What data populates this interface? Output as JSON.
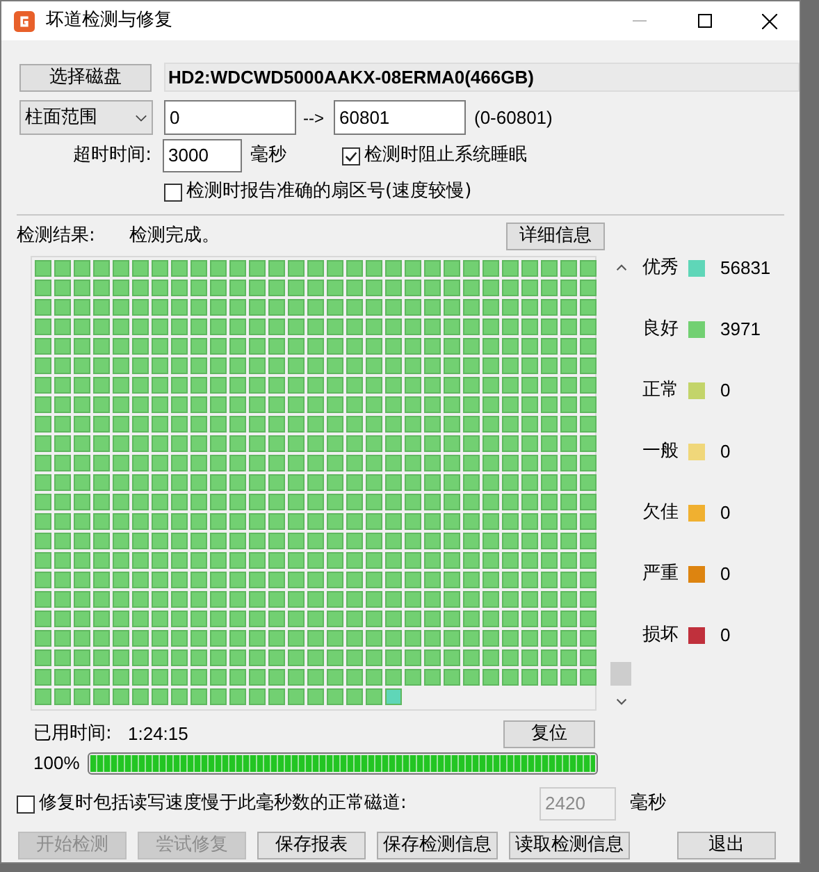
{
  "window": {
    "title": "坏道检测与修复"
  },
  "disk": {
    "button": "选择磁盘",
    "name": "HD2:WDCWD5000AAKX-08ERMA0(466GB)"
  },
  "range": {
    "mode": "柱面范围",
    "from": "0",
    "arrow": "-->",
    "to": "60801",
    "hint": "(0-60801)"
  },
  "timeout": {
    "label": "超时时间:",
    "value": "3000",
    "unit": "毫秒"
  },
  "options": [
    {
      "label": "检测时阻止系统睡眠",
      "checked": true
    },
    {
      "label": "检测时报告准确的扇区号(速度较慢)",
      "checked": false
    }
  ],
  "result": {
    "label": "检测结果:",
    "status": "检测完成。",
    "details_button": "详细信息"
  },
  "legend": [
    {
      "label": "优秀",
      "color": "#5fd6b8",
      "count": "56831"
    },
    {
      "label": "良好",
      "color": "#72d072",
      "count": "3971"
    },
    {
      "label": "正常",
      "color": "#c3d46a",
      "count": "0"
    },
    {
      "label": "一般",
      "color": "#f0d77a",
      "count": "0"
    },
    {
      "label": "欠佳",
      "color": "#f0b030",
      "count": "0"
    },
    {
      "label": "严重",
      "color": "#dd8410",
      "count": "0"
    },
    {
      "label": "损坏",
      "color": "#c0303c",
      "count": "0"
    }
  ],
  "elapsed": {
    "label": "已用时间:",
    "value": "1:24:15",
    "reset_button": "复位"
  },
  "progress": {
    "text": "100%",
    "level": 1
  },
  "repair_slow": {
    "label": "修复时包括读写速度慢于此毫秒数的正常磁道:",
    "checked": false,
    "value": "2420",
    "unit": "毫秒",
    "disabled": true
  },
  "buttons": [
    {
      "label": "开始检测",
      "disabled": true
    },
    {
      "label": "尝试修复",
      "disabled": true
    },
    {
      "label": "保存报表",
      "disabled": false
    },
    {
      "label": "保存检测信息",
      "disabled": false
    },
    {
      "label": "读取检测信息",
      "disabled": false
    },
    {
      "label": "退出",
      "disabled": false
    }
  ]
}
